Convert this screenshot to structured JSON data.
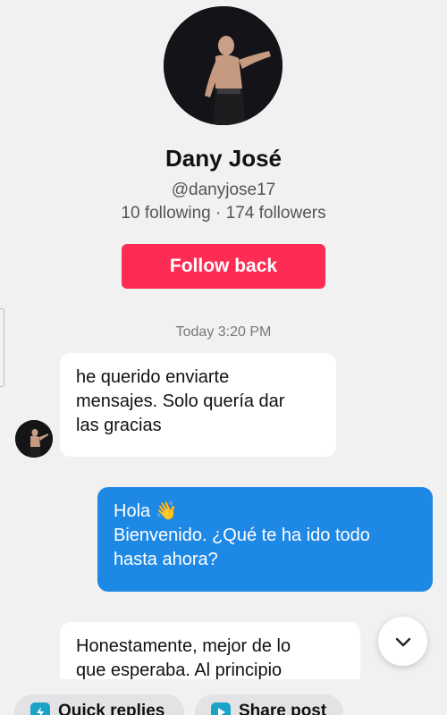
{
  "profile": {
    "name": "Dany José",
    "handle": "@danyjose17",
    "stats": "10 following · 174 followers",
    "follow_button": "Follow back"
  },
  "conversation": {
    "timestamp": "Today 3:20 PM",
    "messages": [
      {
        "sender": "other",
        "text": "he querido enviarte\nmensajes. Solo quería dar\nlas gracias"
      },
      {
        "sender": "me",
        "text": "Hola 👋\nBienvenido. ¿Qué te ha ido todo\nhasta ahora?"
      },
      {
        "sender": "other",
        "text": "Honestamente, mejor de lo\nque esperaba. Al principio"
      }
    ]
  },
  "bottom_bar": {
    "quick_replies": "Quick replies",
    "share_post": "Share post"
  },
  "colors": {
    "follow_button": "#fe2c55",
    "outgoing_bubble": "#1e88e5",
    "incoming_bubble": "#ffffff",
    "background": "#f1f1f2"
  },
  "icons": {
    "scroll_down": "chevron-down-icon",
    "quick_replies": "lightning-icon",
    "share_post": "play-icon"
  }
}
